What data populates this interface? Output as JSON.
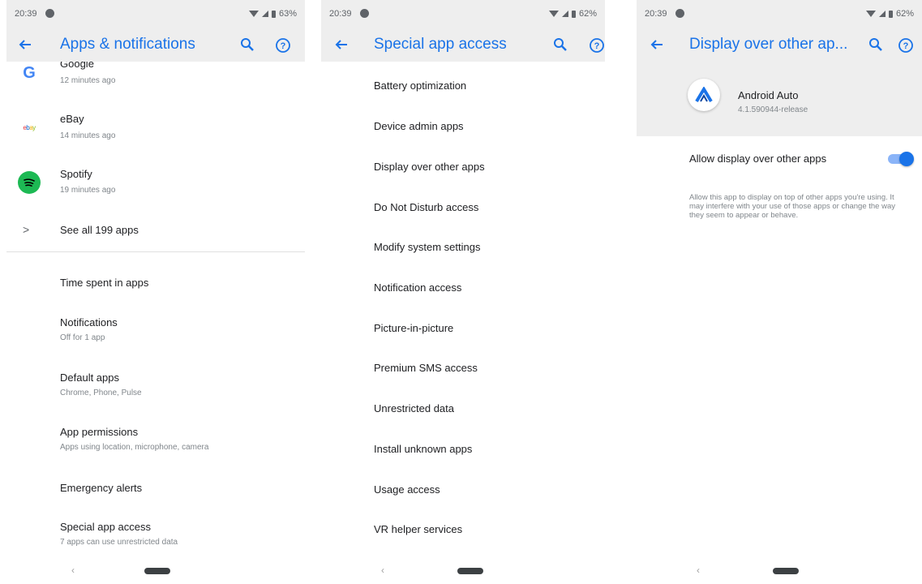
{
  "status": {
    "time": "20:39",
    "battery_left": "63%",
    "battery_mid": "62%",
    "battery_right": "62%"
  },
  "colors": {
    "accent": "#1a73e8",
    "toolbar_bg": "#eeeeee",
    "spotify": "#1db954"
  },
  "screen1": {
    "title": "Apps & notifications",
    "apps": [
      {
        "name": "Google",
        "time": "12 minutes ago",
        "icon": "google-icon"
      },
      {
        "name": "eBay",
        "time": "14 minutes ago",
        "icon": "ebay-icon",
        "icon_text": "ebay"
      },
      {
        "name": "Spotify",
        "time": "19 minutes ago",
        "icon": "spotify-icon"
      }
    ],
    "see_all": "See all 199 apps",
    "settings": [
      {
        "title": "Time spent in apps",
        "subtitle": ""
      },
      {
        "title": "Notifications",
        "subtitle": "Off for 1 app"
      },
      {
        "title": "Default apps",
        "subtitle": "Chrome, Phone, Pulse"
      },
      {
        "title": "App permissions",
        "subtitle": "Apps using location, microphone, camera"
      },
      {
        "title": "Emergency alerts",
        "subtitle": ""
      },
      {
        "title": "Special app access",
        "subtitle": "7 apps can use unrestricted data"
      }
    ]
  },
  "screen2": {
    "title": "Special app access",
    "items": [
      "Battery optimization",
      "Device admin apps",
      "Display over other apps",
      "Do Not Disturb access",
      "Modify system settings",
      "Notification access",
      "Picture-in-picture",
      "Premium SMS access",
      "Unrestricted data",
      "Install unknown apps",
      "Usage access",
      "VR helper services"
    ]
  },
  "screen3": {
    "title": "Display over other ap...",
    "app_name": "Android Auto",
    "app_version": "4.1.590944-release",
    "allow_label": "Allow display over other apps",
    "allow_enabled": true,
    "description": "Allow this app to display on top of other apps you're using. It may interfere with your use of those apps or change the way they seem to appear or behave."
  },
  "nav": {
    "back_glyph": "‹"
  }
}
